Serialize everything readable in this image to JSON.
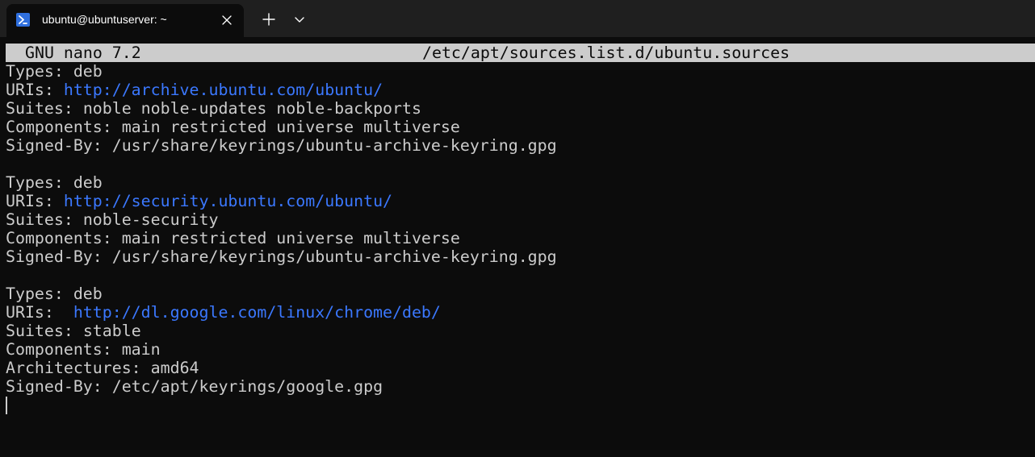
{
  "window": {
    "tab_title": "ubuntu@ubuntuserver: ~",
    "icons": {
      "tab": "powershell-terminal-icon",
      "close": "close-icon",
      "new_tab": "plus-icon",
      "dropdown": "chevron-down-icon"
    },
    "colors": {
      "tabbar_bg": "#1f1f1f",
      "terminal_bg": "#0c0c0c",
      "text": "#cccccc",
      "link": "#3b78ff",
      "header_bg": "#cccccc",
      "icon_accent": "#2f6fde"
    }
  },
  "nano": {
    "version": "GNU nano 7.2",
    "filename": "/etc/apt/sources.list.d/ubuntu.sources"
  },
  "file": {
    "lines": [
      {
        "key": "Types: ",
        "val": "deb",
        "link": false
      },
      {
        "key": "URIs: ",
        "val": "http://archive.ubuntu.com/ubuntu/",
        "link": true
      },
      {
        "key": "Suites: ",
        "val": "noble noble-updates noble-backports",
        "link": false
      },
      {
        "key": "Components: ",
        "val": "main restricted universe multiverse",
        "link": false
      },
      {
        "key": "Signed-By: ",
        "val": "/usr/share/keyrings/ubuntu-archive-keyring.gpg",
        "link": false
      },
      {
        "key": "",
        "val": "",
        "link": false
      },
      {
        "key": "Types: ",
        "val": "deb",
        "link": false
      },
      {
        "key": "URIs: ",
        "val": "http://security.ubuntu.com/ubuntu/",
        "link": true
      },
      {
        "key": "Suites: ",
        "val": "noble-security",
        "link": false
      },
      {
        "key": "Components: ",
        "val": "main restricted universe multiverse",
        "link": false
      },
      {
        "key": "Signed-By: ",
        "val": "/usr/share/keyrings/ubuntu-archive-keyring.gpg",
        "link": false
      },
      {
        "key": "",
        "val": "",
        "link": false
      },
      {
        "key": "Types: ",
        "val": "deb",
        "link": false
      },
      {
        "key": "URIs:  ",
        "val": "http://dl.google.com/linux/chrome/deb/",
        "link": true
      },
      {
        "key": "Suites: ",
        "val": "stable",
        "link": false
      },
      {
        "key": "Components: ",
        "val": "main",
        "link": false
      },
      {
        "key": "Architectures: ",
        "val": "amd64",
        "link": false
      },
      {
        "key": "Signed-By: ",
        "val": "/etc/apt/keyrings/google.gpg",
        "link": false
      }
    ]
  }
}
